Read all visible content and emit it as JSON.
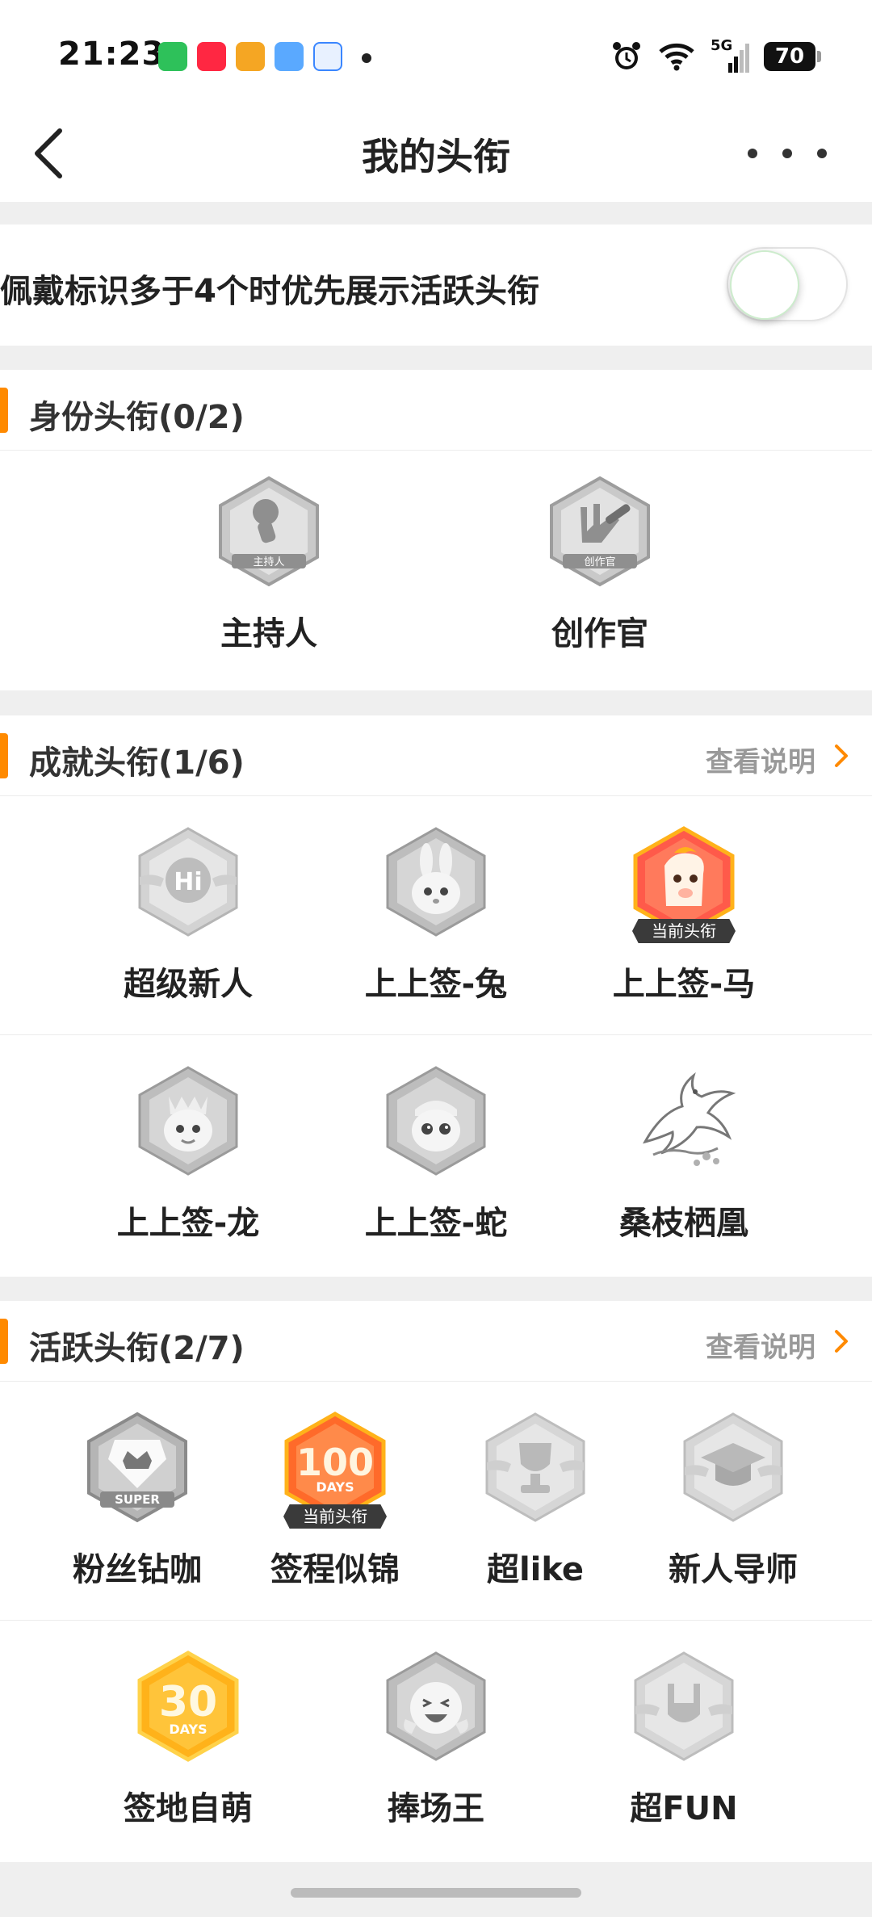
{
  "status_bar": {
    "time": "21:23",
    "network": "5G",
    "battery": "70",
    "notification_icons": [
      "wechat-icon",
      "xiaohongshu-icon",
      "weibo-icon",
      "weather-icon",
      "browser-icon"
    ]
  },
  "nav": {
    "title": "我的头衔"
  },
  "toggle_row": {
    "label": "佩戴标识多于4个时优先展示活跃头衔",
    "checked": false
  },
  "identity_section": {
    "title": "身份头衔(0/2)",
    "items": [
      {
        "label": "主持人",
        "badge_text": "主持人",
        "icon": "microphone-badge-icon",
        "active": false
      },
      {
        "label": "创作官",
        "badge_text": "创作官",
        "icon": "pencil-hand-badge-icon",
        "active": false
      }
    ]
  },
  "achievement_section": {
    "title": "成就头衔(1/6)",
    "link": "查看说明",
    "items": [
      {
        "label": "超级新人",
        "badge_text": "Hi",
        "icon": "hi-badge-icon",
        "active": false
      },
      {
        "label": "上上签-兔",
        "icon": "rabbit-badge-icon",
        "active": false
      },
      {
        "label": "上上签-马",
        "icon": "horse-badge-icon",
        "active": true,
        "ribbon": "当前头衔"
      },
      {
        "label": "上上签-龙",
        "icon": "dragon-badge-icon",
        "active": false
      },
      {
        "label": "上上签-蛇",
        "icon": "snake-badge-icon",
        "active": false
      },
      {
        "label": "桑枝栖凰",
        "icon": "phoenix-icon",
        "active": false
      }
    ]
  },
  "active_section": {
    "title": "活跃头衔(2/7)",
    "link": "查看说明",
    "items": [
      {
        "label": "粉丝钻咖",
        "badge_text": "SUPER",
        "icon": "super-crown-badge-icon",
        "active": false
      },
      {
        "label": "签程似锦",
        "badge_text": "100",
        "badge_sub": "DAYS",
        "icon": "100-days-badge-icon",
        "active": true,
        "ribbon": "当前头衔"
      },
      {
        "label": "超like",
        "icon": "trophy-badge-icon",
        "active": false
      },
      {
        "label": "新人导师",
        "icon": "graduation-cap-badge-icon",
        "active": false
      },
      {
        "label": "签地自萌",
        "badge_text": "30",
        "badge_sub": "DAYS",
        "icon": "30-days-badge-icon",
        "active": true
      },
      {
        "label": "捧场王",
        "icon": "cheering-face-badge-icon",
        "active": false
      },
      {
        "label": "超FUN",
        "icon": "rock-hand-badge-icon",
        "active": false
      }
    ]
  },
  "colors": {
    "accent": "#ff8a00",
    "background": "#efefef",
    "badge_gray": "#b9b9b9",
    "active_red": "#ff5a4a",
    "active_gold": "#ffb21a"
  }
}
